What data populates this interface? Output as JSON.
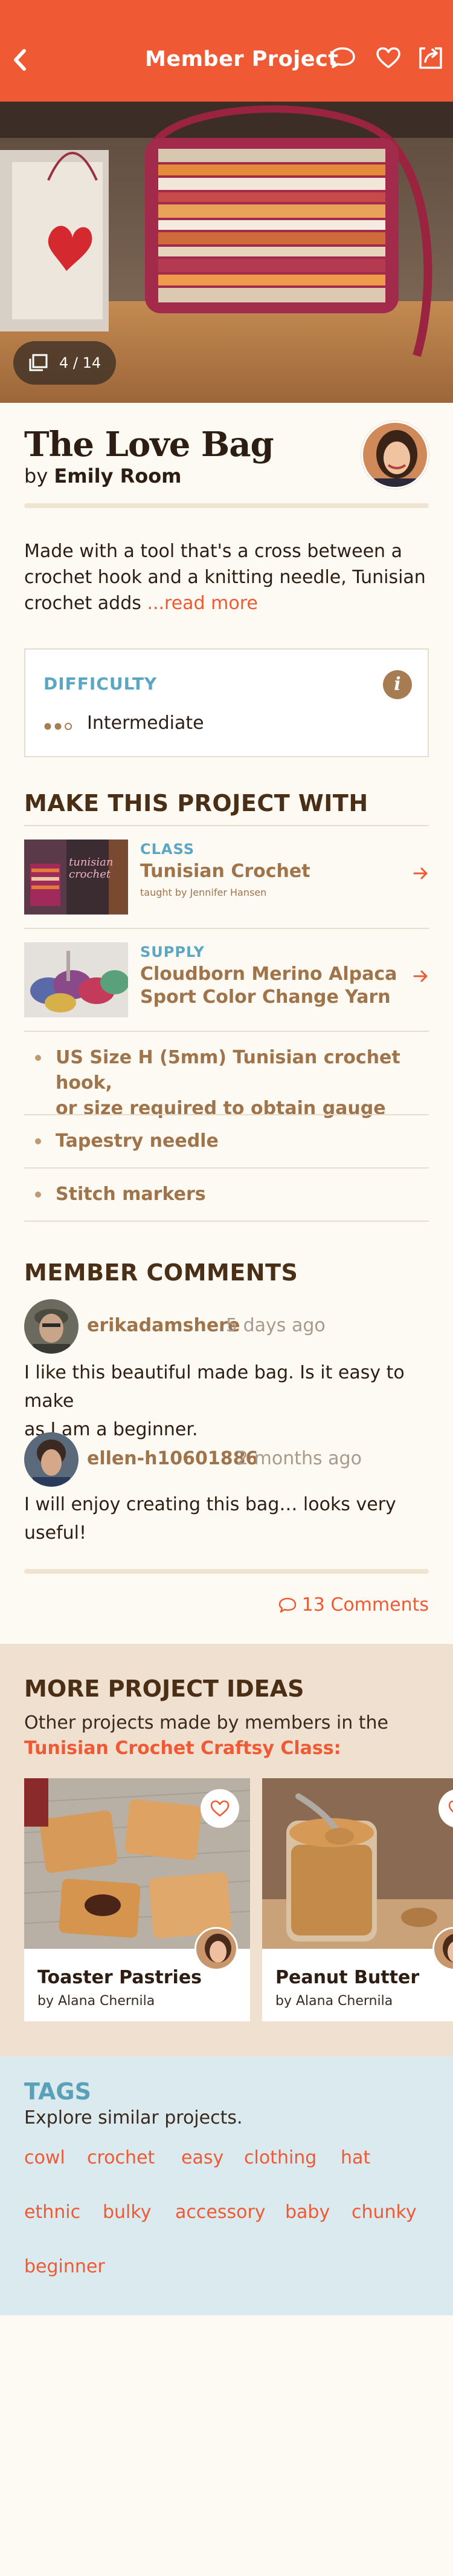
{
  "header": {
    "title": "Member Project"
  },
  "hero": {
    "counter": "4 / 14"
  },
  "project": {
    "title": "The Love Bag",
    "by_prefix": "by",
    "author": "Emily Room",
    "description_line1": "Made with a tool that's a cross between a",
    "description_line2": "crochet hook and a knitting needle, Tunisian",
    "description_line3": "crochet adds",
    "read_more": "...read more"
  },
  "difficulty": {
    "label": "DIFFICULTY",
    "value": "Intermediate",
    "info": "i"
  },
  "make_with": {
    "title": "MAKE THIS PROJECT WITH",
    "items": [
      {
        "type": "CLASS",
        "name": "Tunisian Crochet",
        "sub": "taught by Jennifer Hansen",
        "thumb_text": "tunisian crochet"
      },
      {
        "type": "SUPPLY",
        "name_line1": "Cloudborn Merino Alpaca",
        "name_line2": "Sport Color Change Yarn"
      }
    ],
    "bullets": [
      {
        "line1": "US Size H (5mm) Tunisian crochet hook,",
        "line2": "or size required to obtain gauge"
      },
      {
        "line1": "Tapestry needle"
      },
      {
        "line1": "Stitch markers"
      }
    ]
  },
  "comments": {
    "title": "MEMBER COMMENTS",
    "items": [
      {
        "user": "erikadamshere",
        "time": "5 days ago",
        "text_line1": "I like this beautiful made bag. Is it easy to make",
        "text_line2": "as I am a beginner."
      },
      {
        "user": "ellen-h10601886",
        "time": "2 months ago",
        "text_line1": "I will enjoy creating this bag… looks very",
        "text_line2": "useful!"
      }
    ],
    "count_link": "13 Comments"
  },
  "more_ideas": {
    "title": "MORE PROJECT IDEAS",
    "sub": "Other projects made by members in the",
    "class_link": "Tunisian Crochet Craftsy Class:",
    "cards": [
      {
        "title": "Toaster Pastries",
        "by": "by Alana Chernila"
      },
      {
        "title": "Peanut Butter",
        "by": "by Alana Chernila"
      }
    ]
  },
  "tags": {
    "title": "TAGS",
    "sub": "Explore similar projects.",
    "list": [
      "cowl",
      "crochet",
      "easy",
      "clothing",
      "hat",
      "ethnic",
      "bulky",
      "accessory",
      "baby",
      "chunky",
      "beginner"
    ]
  },
  "colors": {
    "brand": "#ef5a34",
    "accent_blue": "#5aa7c3",
    "brown": "#a0744a",
    "tags_bg": "#dbeaee",
    "more_bg": "#efe0cf"
  }
}
